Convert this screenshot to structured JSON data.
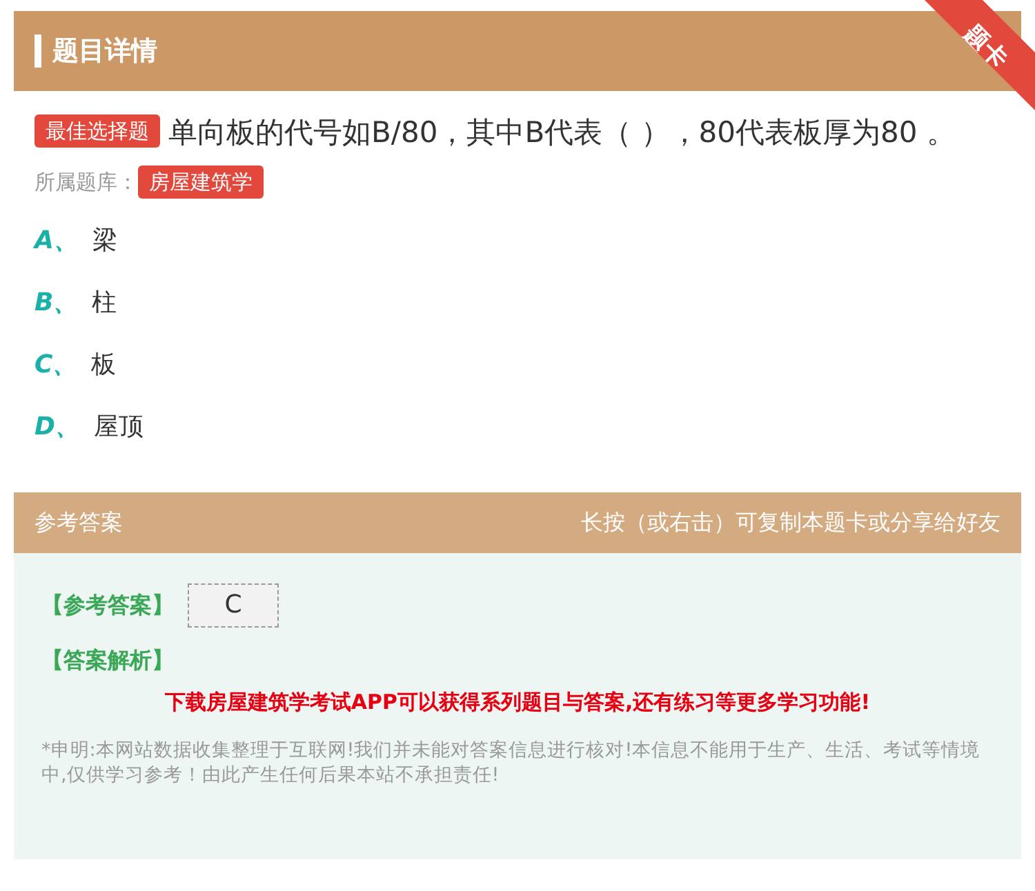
{
  "header": {
    "title": "题目详情",
    "corner_ribbon": "题卡"
  },
  "question": {
    "type_tag": "最佳选择题",
    "text": "单向板的代号如B/80，其中B代表（ ），80代表板厚为80 。",
    "bank_label": "所属题库：",
    "bank_tag": "房屋建筑学"
  },
  "options": [
    {
      "letter": "A、",
      "text": "梁"
    },
    {
      "letter": "B、",
      "text": "柱"
    },
    {
      "letter": "C、",
      "text": "板"
    },
    {
      "letter": "D、",
      "text": "屋顶"
    }
  ],
  "answer_bar": {
    "title": "参考答案",
    "hint": "长按（或右击）可复制本题卡或分享给好友"
  },
  "answer": {
    "answer_label": "【参考答案】",
    "answer_value": "C",
    "analysis_label": "【答案解析】",
    "promo": "下载房屋建筑学考试APP可以获得系列题目与答案,还有练习等更多学习功能!",
    "disclaimer": "*申明:本网站数据收集整理于互联网!我们并未能对答案信息进行核对!本信息不能用于生产、生活、考试等情境中,仅供学习参考！由此产生任何后果本站不承担责任!"
  }
}
